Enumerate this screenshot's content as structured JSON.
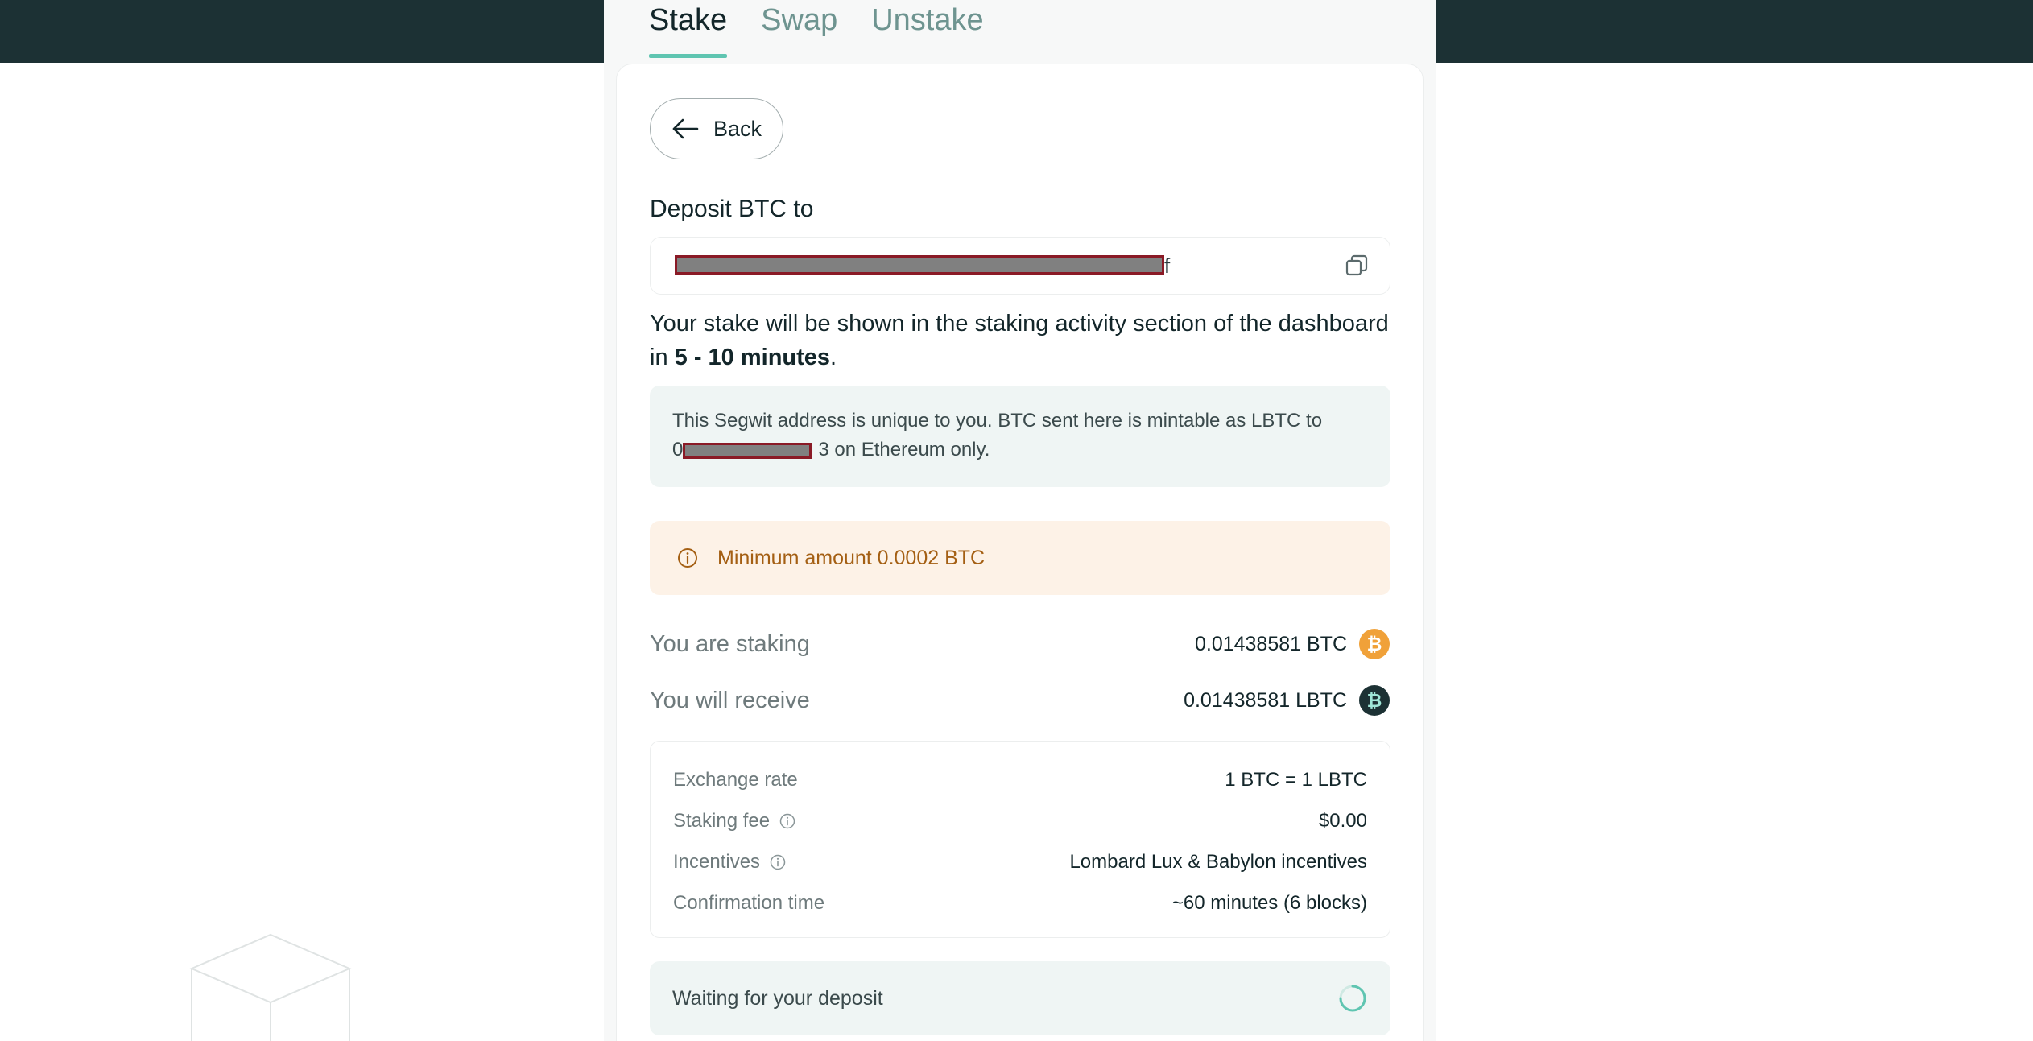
{
  "tabs": [
    {
      "label": "Stake",
      "active": true
    },
    {
      "label": "Swap",
      "active": false
    },
    {
      "label": "Unstake",
      "active": false
    }
  ],
  "back_button": {
    "label": "Back",
    "icon": "arrow-left-icon"
  },
  "deposit": {
    "label": "Deposit BTC to",
    "address_visible_tail": "f",
    "copy_icon": "copy-icon"
  },
  "stake_note": {
    "prefix": "Your stake will be shown in the staking activity section of the dashboard in ",
    "emphasis": "5 - 10 minutes",
    "suffix": "."
  },
  "segwit_info": {
    "line1": "This Segwit address is unique to you. BTC sent here is mintable as LBTC to",
    "addr_start": "0",
    "addr_end": "3",
    "line2_suffix": " on Ethereum only."
  },
  "warning": {
    "text": "Minimum amount 0.0002 BTC",
    "icon": "info-circle-icon",
    "color": "#a45f13"
  },
  "summary": {
    "staking_label": "You are staking",
    "staking_value": "0.01438581 BTC",
    "receive_label": "You will receive",
    "receive_value": "0.01438581 LBTC"
  },
  "details": [
    {
      "label": "Exchange rate",
      "value": "1 BTC = 1 LBTC",
      "info": false
    },
    {
      "label": "Staking fee",
      "value": "$0.00",
      "info": true
    },
    {
      "label": "Incentives",
      "value": "Lombard Lux & Babylon incentives",
      "info": true
    },
    {
      "label": "Confirmation time",
      "value": "~60 minutes (6 blocks)",
      "info": false
    }
  ],
  "waiting": {
    "text": "Waiting for your deposit",
    "icon": "spinner-icon"
  },
  "colors": {
    "header_bg": "#1c3134",
    "tab_active_underline": "#5fc5b1",
    "btc_orange": "#f0a139",
    "lbtc_dark": "#1c3134",
    "info_bg": "#eff5f4",
    "warning_bg": "#fdf2e7"
  }
}
